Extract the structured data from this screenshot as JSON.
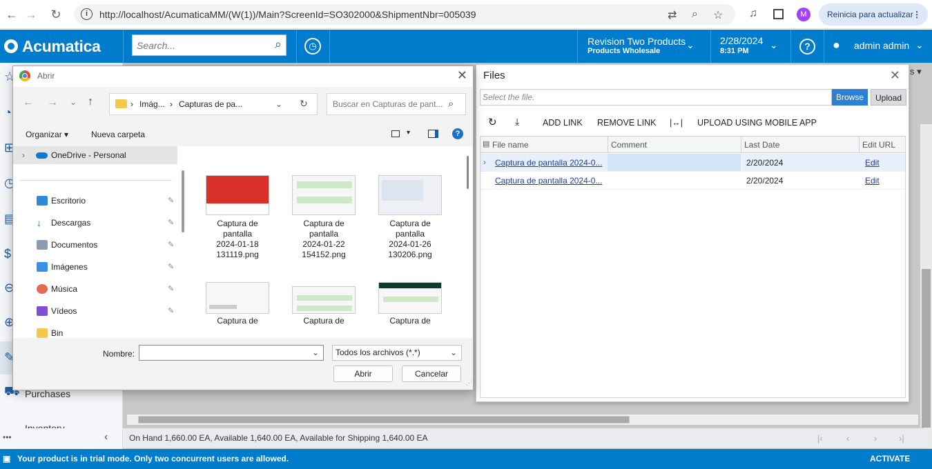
{
  "browser": {
    "url": "http://localhost/AcumaticaMM/(W(1))/Main?ScreenId=SO302000&ShipmentNbr=005039",
    "profile_initial": "M",
    "reload_pill": "Reinicia para actualizar"
  },
  "header": {
    "logo": "Acumatica",
    "search_placeholder": "Search...",
    "company_name": "Revision Two Products",
    "branch_name": "Products Wholesale",
    "date": "2/28/2024",
    "time": "8:31 PM",
    "user": "admin admin"
  },
  "left_nav": {
    "purchases_label": "Purchases",
    "inventory_label": "Inventory"
  },
  "status_bar": {
    "text": "On Hand 1,660.00 EA, Available 1,640.00 EA, Available for Shipping 1,640.00 EA"
  },
  "trial_bar": {
    "message": "Your product is in trial mode. Only two concurrent users are allowed.",
    "activate_label": "ACTIVATE"
  },
  "files_dialog": {
    "title": "Files",
    "file_placeholder": "Select the file.",
    "browse_label": "Browse",
    "upload_label": "Upload",
    "toolbar": {
      "add_link": "ADD LINK",
      "remove_link": "REMOVE LINK",
      "upload_mobile": "UPLOAD USING MOBILE APP"
    },
    "columns": [
      "File name",
      "Comment",
      "Last Date",
      "Edit URL"
    ],
    "rows": [
      {
        "file": "Captura de pantalla 2024-0...",
        "comment": "",
        "date": "2/20/2024",
        "edit": "Edit"
      },
      {
        "file": "Captura de pantalla 2024-0...",
        "comment": "",
        "date": "2/20/2024",
        "edit": "Edit"
      }
    ]
  },
  "open_dialog": {
    "title": "Abrir",
    "breadcrumb_1": "Imág...",
    "breadcrumb_2": "Capturas de pa...",
    "search_placeholder": "Buscar en Capturas de pant...",
    "organize_label": "Organizar",
    "new_folder_label": "Nueva carpeta",
    "nav": {
      "onedrive": "OneDrive - Personal",
      "items": [
        "Escritorio",
        "Descargas",
        "Documentos",
        "Imágenes",
        "Música",
        "Vídeos",
        "Bin"
      ]
    },
    "files": [
      {
        "l1": "Captura de",
        "l2": "pantalla",
        "l3": "2024-01-18",
        "l4": "131119.png"
      },
      {
        "l1": "Captura de",
        "l2": "pantalla",
        "l3": "2024-01-22",
        "l4": "154152.png"
      },
      {
        "l1": "Captura de",
        "l2": "pantalla",
        "l3": "2024-01-26",
        "l4": "130206.png"
      },
      {
        "l1": "Captura de"
      },
      {
        "l1": "Captura de"
      },
      {
        "l1": "Captura de"
      }
    ],
    "filename_label": "Nombre:",
    "filter_label": "Todos los archivos (*.*)",
    "open_label": "Abrir",
    "cancel_label": "Cancelar"
  },
  "colors": {
    "accent": "#007ccd",
    "link": "#1e3c9c"
  }
}
